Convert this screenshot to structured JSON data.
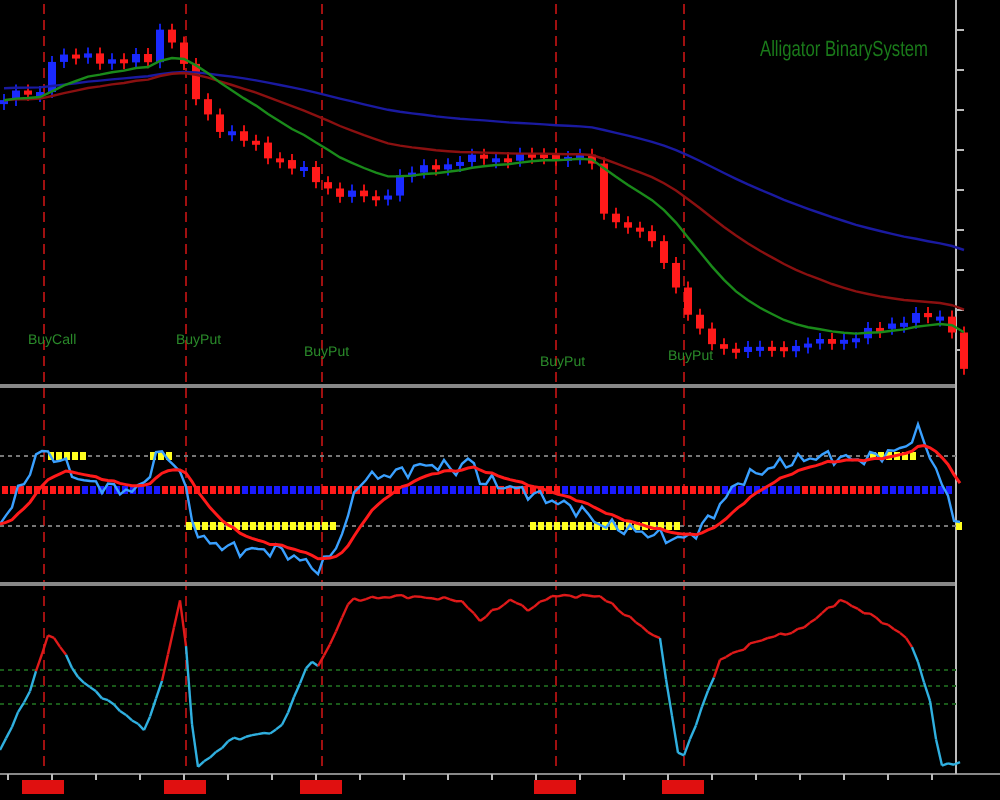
{
  "chart": {
    "title": "Alligator BinarySystem",
    "signals": [
      {
        "label": "BuyCall"
      },
      {
        "label": "BuyPut"
      },
      {
        "label": "BuyPut"
      },
      {
        "label": "BuyPut"
      },
      {
        "label": "BuyPut"
      }
    ]
  }
}
